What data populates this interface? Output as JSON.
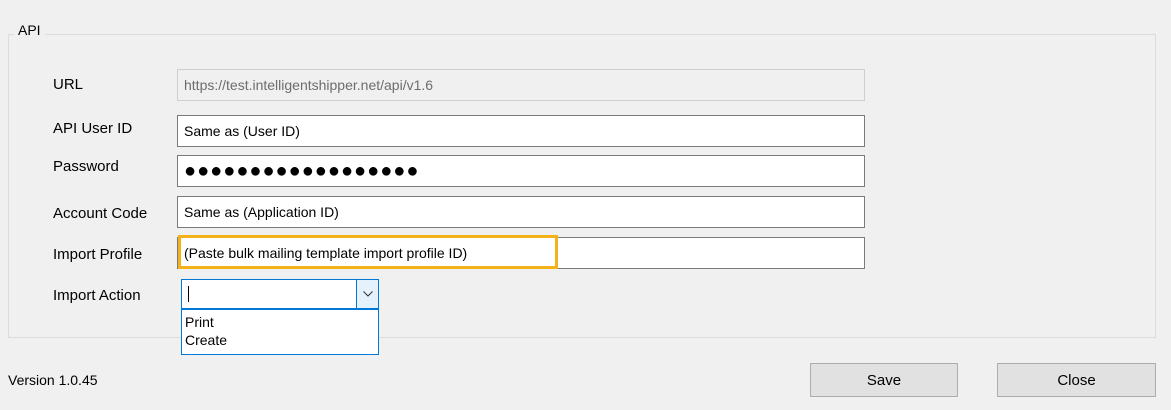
{
  "group": {
    "title": "API"
  },
  "fields": {
    "url": {
      "label": "URL",
      "value": "https://test.intelligentshipper.net/api/v1.6"
    },
    "api_user_id": {
      "label": "API User ID",
      "value": "Same as  (User ID)"
    },
    "password": {
      "label": "Password",
      "value": "●●●●●●●●●●●●●●●●●●"
    },
    "account_code": {
      "label": "Account Code",
      "value": "Same as (Application ID)"
    },
    "import_profile": {
      "label": "Import Profile",
      "value": "(Paste bulk mailing template import profile ID)"
    },
    "import_action": {
      "label": "Import Action",
      "value": "",
      "options": [
        "Print",
        "Create"
      ]
    }
  },
  "footer": {
    "version": "Version 1.0.45",
    "save_label": "Save",
    "close_label": "Close"
  },
  "colors": {
    "highlight": "#f2b21a",
    "focus": "#0078d7"
  },
  "icons": {
    "combo_arrow": "chevron-down-icon"
  }
}
